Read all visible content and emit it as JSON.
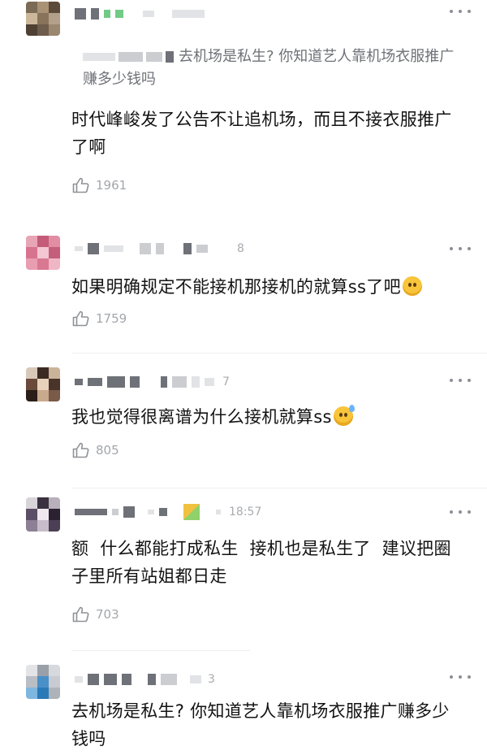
{
  "comments": [
    {
      "time": "",
      "quote_text": "去机场是私生? 你知道艺人靠机场衣服推广赚多少钱吗",
      "text": "时代峰峻发了公告不让追机场，而且不接衣服推广了啊",
      "likes": "1961"
    },
    {
      "time": "8",
      "text": "如果明确规定不能接机那接机的就算ss了吧",
      "emoji": "thinking-face-emoji",
      "likes": "1759"
    },
    {
      "time": "7",
      "text": "我也觉得很离谱为什么接机就算ss",
      "emoji": "sweat-smile-emoji",
      "likes": "805"
    },
    {
      "time": "18:57",
      "text": "额  什么都能打成私生  接机也是私生了  建议把圈子里所有站姐都日走",
      "likes": "703"
    },
    {
      "time": "3",
      "text": "去机场是私生? 你知道艺人靠机场衣服推广赚多少钱吗"
    }
  ],
  "icons": {
    "like": "thumbs-up-icon",
    "more": "more-dots-icon"
  },
  "colors": {
    "text": "#131313",
    "meta": "#a3a6ab",
    "quote": "#6e7177",
    "divider": "#eeeff1"
  }
}
